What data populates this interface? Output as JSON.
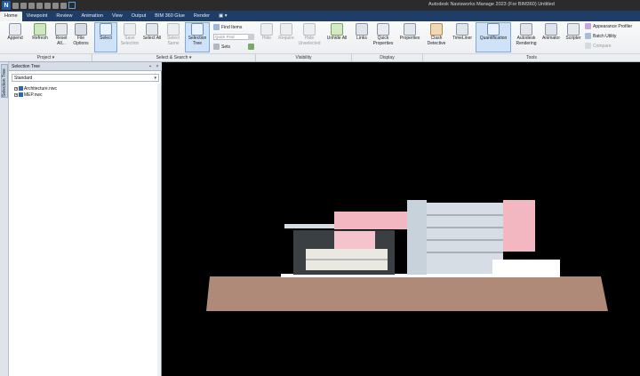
{
  "titlebar": {
    "app_letter": "N",
    "title": "Autodesk Navisworks Manage 2023 (For BIM360)    Untitled"
  },
  "tabs": [
    "Home",
    "Viewpoint",
    "Review",
    "Animation",
    "View",
    "Output",
    "BIM 360 Glue",
    "Render",
    "▣ ▾"
  ],
  "ribbon": {
    "append": "Append",
    "refresh": "Refresh",
    "reset_all": "Reset All...",
    "file_options": "File Options",
    "select": "Select",
    "save_selection": "Save Selection",
    "select_all": "Select All",
    "select_same": "Select Same",
    "selection_tree": "Selection Tree",
    "find_items": "Find Items",
    "quick_find_placeholder": "Quick Find",
    "sets": "Sets",
    "hide": "Hide",
    "require": "Require",
    "hide_unselected": "Hide Unselected",
    "unhide_all": "Unhide All",
    "links": "Links",
    "quick_properties": "Quick Properties",
    "properties": "Properties",
    "clash_detective": "Clash Detective",
    "timeliner": "TimeLiner",
    "quantification": "Quantification",
    "autodesk_rendering": "Autodesk Rendering",
    "animator": "Animator",
    "scripter": "Scripter",
    "appearance_profiler": "Appearance Profiler",
    "batch_utility": "Batch Utility",
    "compare": "Compare",
    "groups": {
      "project": "Project ▾",
      "select_search": "Select & Search ▾",
      "visibility": "Visibility",
      "display": "Display",
      "tools": "Tools"
    }
  },
  "sidetab": {
    "label": "Selection Tree"
  },
  "panel": {
    "title": "Selection Tree",
    "mode": "Standard",
    "items": [
      {
        "label": "Architecture.nwc"
      },
      {
        "label": "MEP.nwc"
      }
    ]
  }
}
